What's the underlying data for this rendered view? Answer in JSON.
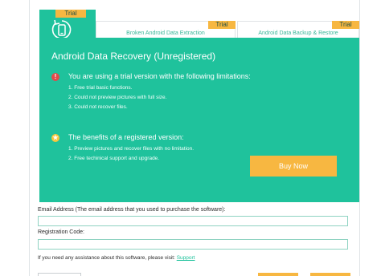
{
  "tabs": {
    "active": {
      "badge": "Trial",
      "icon": "phone-recovery-icon"
    },
    "broken": {
      "label": "Broken Android Data Extraction",
      "badge": "Trial"
    },
    "backup": {
      "label": "Android Data Backup & Restore",
      "badge": "Trial"
    }
  },
  "panel": {
    "title": "Android Data Recovery (Unregistered)",
    "trial_heading": "You are using a trial version with the following limitations:",
    "limitations": [
      "1. Free trial basic functions.",
      "2. Could not preview pictures with full size.",
      "3. Could not recover files."
    ],
    "benefits_heading": "The benefits of a registered version:",
    "benefits": [
      "1. Preview pictures and recover files with no limitation.",
      "2. Free techinical support and upgrade."
    ],
    "buy_label": "Buy Now"
  },
  "form": {
    "email_label": "Email Address (The email address that you used to purchase the software):",
    "email_value": "",
    "code_label": "Registration Code:",
    "code_value": "",
    "help_text": "If you need any assistance about this software, please visit:",
    "help_link": "Support"
  },
  "colors": {
    "accent": "#1fc29c",
    "badge": "#f7b741",
    "warning": "#e24a4a",
    "star": "#f7c63d"
  }
}
